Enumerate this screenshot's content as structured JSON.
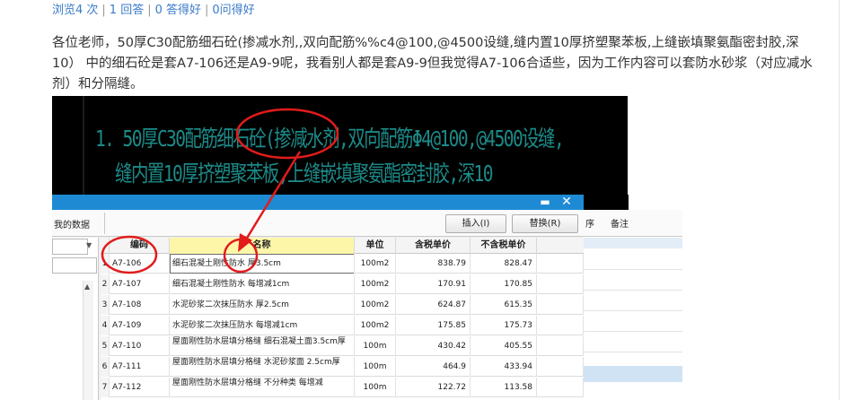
{
  "post": {
    "stats": {
      "views": "浏览4 次",
      "answers": "1 回答",
      "good_answers": "0 答得好",
      "good_questions": "0问得好"
    },
    "question": "各位老师，50厚C30配筋细石砼(掺减水剂,,双向配筋%%c4@100,@4500设缝,缝内置10厚挤塑聚苯板,上缝嵌填聚氨酯密封胶,深10） 中的细石砼是套A7-106还是A9-9呢，我看别人都是套A9-9但我觉得A7-106合适些，因为工作内容可以套防水砂浆（对应减水剂）和分隔缝。"
  },
  "cad": {
    "line1": "1. 50厚C30配筋细石砼(掺减水剂,双向配筋Φ4@100,@4500设缝,",
    "line2": "缝内置10厚挤塑聚苯板,上缝嵌填聚氨酯密封胶,深10"
  },
  "app": {
    "title_controls": {
      "minimize": "▬",
      "close": "✕"
    },
    "toolbar": {
      "my_data": "我的数据",
      "insert": "插入(I)",
      "replace": "替换(R)"
    },
    "right_pane": {
      "col1": "序",
      "col2": "备注"
    },
    "table": {
      "headers": [
        "编码",
        "名称",
        "单位",
        "含税单价",
        "不含税单价"
      ],
      "rows": [
        {
          "no": "1",
          "code": "A7-106",
          "name": "细石混凝土刚性防水 厚3.5cm",
          "unit": "100m2",
          "price": "838.79",
          "nprice": "828.47"
        },
        {
          "no": "2",
          "code": "A7-107",
          "name": "细石混凝土刚性防水 每增减1cm",
          "unit": "100m2",
          "price": "170.91",
          "nprice": "170.85"
        },
        {
          "no": "3",
          "code": "A7-108",
          "name": "水泥砂浆二次抹压防水 厚2.5cm",
          "unit": "100m2",
          "price": "624.87",
          "nprice": "615.35"
        },
        {
          "no": "4",
          "code": "A7-109",
          "name": "水泥砂浆二次抹压防水 每增减1cm",
          "unit": "100m2",
          "price": "175.85",
          "nprice": "175.73"
        },
        {
          "no": "5",
          "code": "A7-110",
          "name": "屋面刚性防水层填分格缝 细石混凝土面3.5cm厚",
          "unit": "100m",
          "price": "430.42",
          "nprice": "405.55"
        },
        {
          "no": "6",
          "code": "A7-111",
          "name": "屋面刚性防水层填分格缝 水泥砂浆面 2.5cm厚",
          "unit": "100m",
          "price": "464.9",
          "nprice": "433.94"
        },
        {
          "no": "7",
          "code": "A7-112",
          "name": "屋面刚性防水层填分格缝 不分种类 每增减",
          "unit": "100m",
          "price": "122.72",
          "nprice": "113.58"
        }
      ]
    }
  },
  "annotation_color": "#e21b1b"
}
